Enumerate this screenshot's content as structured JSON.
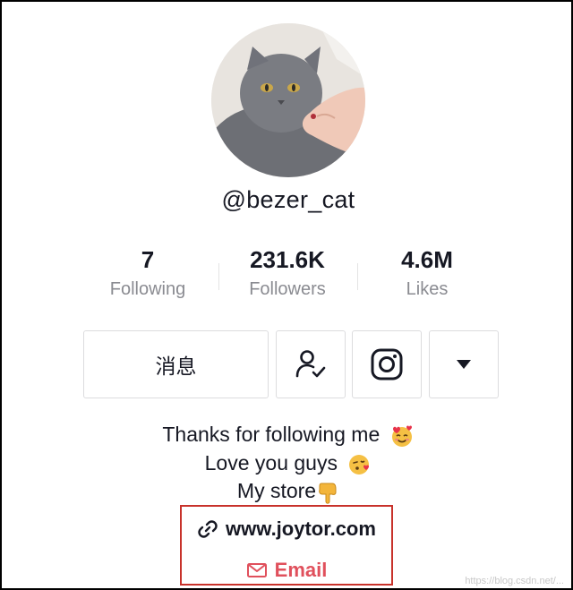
{
  "profile": {
    "handle": "@bezer_cat",
    "avatar_icon": "cat-avatar"
  },
  "stats": [
    {
      "value": "7",
      "label": "Following"
    },
    {
      "value": "231.6K",
      "label": "Followers"
    },
    {
      "value": "4.6M",
      "label": "Likes"
    }
  ],
  "actions": {
    "message_label": "消息",
    "follow_icon": "user-check-icon",
    "instagram_icon": "instagram-icon",
    "more_icon": "caret-down-icon"
  },
  "bio": {
    "line1": "Thanks for following me",
    "line2": "Love you guys",
    "line3": "My store"
  },
  "links": {
    "website": "www.joytor.com",
    "email": "Email"
  },
  "colors": {
    "highlight_border": "#c8322b",
    "email_red": "#e0505c",
    "muted": "#8a8b91"
  },
  "watermark": "https://blog.csdn.net/..."
}
